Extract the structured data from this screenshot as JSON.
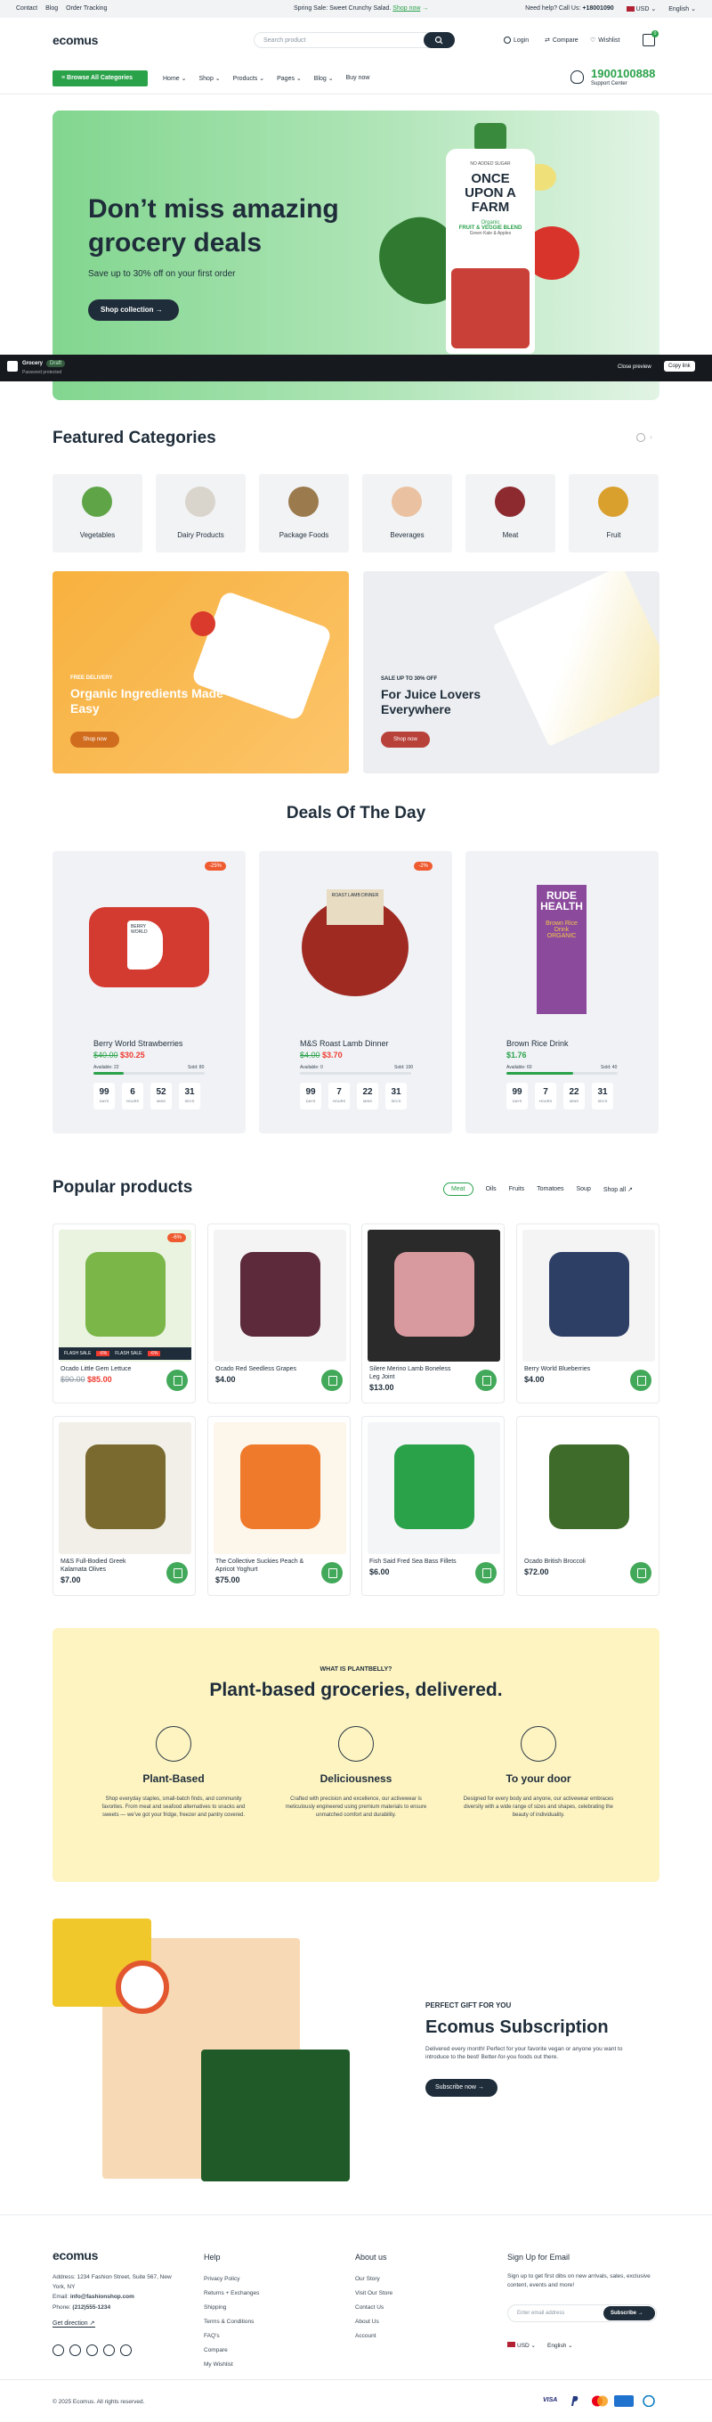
{
  "topbar": {
    "links": [
      "Contact",
      "Blog",
      "Order Tracking"
    ],
    "promo_text": "Spring Sale: Sweet Crunchy Salad.",
    "promo_link": "Shop now",
    "help_text": "Need help? Call Us:",
    "help_phone": "+18001090",
    "currency": "USD",
    "language": "English"
  },
  "header": {
    "logo": "ecomus",
    "search_placeholder": "Search product",
    "login": "Login",
    "compare": "Compare",
    "wishlist": "Wishlist",
    "cart_count": "0"
  },
  "nav": {
    "browse": "Browse All Categories",
    "items": [
      "Home",
      "Shop",
      "Products",
      "Pages",
      "Blog",
      "Buy now"
    ],
    "hotline": "1900100888",
    "hotline_sub": "Support Center"
  },
  "hero": {
    "title": "Don’t miss amazing grocery deals",
    "subtitle": "Save up to 30% off on your first order",
    "button": "Shop collection",
    "pack_line1": "NO ADDED SUGAR",
    "pack_brand": "ONCE UPON A FARM",
    "pack_line2": "Organic",
    "pack_line3": "FRUIT & VEGGIE BLEND",
    "pack_line4": "Green Kale & Apples"
  },
  "preview_bar": {
    "store": "Grocery",
    "badge": "Draft",
    "sub": "Password protected",
    "close": "Close preview",
    "copy": "Copy link"
  },
  "featured": {
    "title": "Featured Categories",
    "items": [
      {
        "label": "Vegetables",
        "color": "#5fa548"
      },
      {
        "label": "Dairy Products",
        "color": "#d9d4cc"
      },
      {
        "label": "Package Foods",
        "color": "#9b7a4e"
      },
      {
        "label": "Beverages",
        "color": "#eac2a1"
      },
      {
        "label": "Meat",
        "color": "#8c2a2f"
      },
      {
        "label": "Fruit",
        "color": "#d9a02d"
      }
    ]
  },
  "promos": [
    {
      "small": "FREE DELIVERY",
      "big": "Organic Ingredients Made Easy",
      "button": "Shop now"
    },
    {
      "small": "SALE UP TO 30% OFF",
      "big": "For Juice Lovers Everywhere",
      "button": "Shop now"
    }
  ],
  "deals": {
    "title": "Deals Of The Day",
    "items": [
      {
        "discount": "-25%",
        "name": "Berry World Strawberries",
        "old_price": "$40.00",
        "price": "$30.25",
        "available": "Available: 22",
        "sold": "Sold: 80",
        "progress": 0.27,
        "timer": [
          "99",
          "6",
          "52",
          "31"
        ],
        "pack_brand": "BERRY WORLD",
        "pack_text": "BRITISH STRAWBERRIES"
      },
      {
        "discount": "-2%",
        "name": "M&S Roast Lamb Dinner",
        "old_price": "$4.00",
        "price": "$3.70",
        "available": "Available: 0",
        "sold": "Sold: 100",
        "progress": 0.0,
        "timer": [
          "99",
          "7",
          "22",
          "31"
        ],
        "pack_brand": "M&S",
        "pack_text": "ROAST LAMB DINNER"
      },
      {
        "discount": "",
        "name": "Brown Rice Drink",
        "old_price": "",
        "price": "$1.76",
        "available": "Available: 60",
        "sold": "Sold: 40",
        "progress": 0.6,
        "timer": [
          "99",
          "7",
          "22",
          "31"
        ],
        "pack_brand": "RUDE HEALTH",
        "pack_text": "Brown Rice Drink ORGANIC"
      }
    ],
    "timer_labels": [
      "DAYS",
      "HOURS",
      "MINS",
      "SECS"
    ]
  },
  "popular": {
    "title": "Popular products",
    "filters": [
      "Meat",
      "Oils",
      "Fruits",
      "Tomatoes",
      "Soup",
      "Shop all"
    ],
    "products": [
      {
        "name": "Ocado Little Gem Lettuce",
        "old_price": "$90.00",
        "price": "$85.00",
        "discount": "-6%",
        "flash": "FLASH SALE",
        "img_color": "#e9f3df",
        "accent": "#7ab648"
      },
      {
        "name": "Ocado Red Seedless Grapes",
        "old_price": "",
        "price": "$4.00",
        "discount": "",
        "img_color": "#f4f4f4",
        "accent": "#5c2a3a"
      },
      {
        "name": "Silere Merino Lamb Boneless Leg Joint",
        "old_price": "",
        "price": "$13.00",
        "discount": "",
        "img_color": "#2a2a2a",
        "accent": "#d89a9e"
      },
      {
        "name": "Berry World Blueberries",
        "old_price": "",
        "price": "$4.00",
        "discount": "",
        "img_color": "#f4f4f4",
        "accent": "#2e3f66"
      },
      {
        "name": "M&S Full-Bodied Greek Kalamata Olives",
        "old_price": "",
        "price": "$7.00",
        "discount": "",
        "img_color": "#f1efe7",
        "accent": "#7a6a2f"
      },
      {
        "name": "The Collective Suckies Peach & Apricot Yoghurt",
        "old_price": "",
        "price": "$75.00",
        "discount": "",
        "img_color": "#fdf6ea",
        "accent": "#ef7a2b"
      },
      {
        "name": "Fish Said Fred Sea Bass Fillets",
        "old_price": "",
        "price": "$6.00",
        "discount": "",
        "img_color": "#f3f5f6",
        "accent": "#2aa24a"
      },
      {
        "name": "Ocado British Broccoli",
        "old_price": "",
        "price": "$72.00",
        "discount": "",
        "img_color": "#ffffff",
        "accent": "#3f6b2a"
      }
    ]
  },
  "plant": {
    "kicker": "WHAT IS PLANTBELLY?",
    "title": "Plant-based groceries, delivered.",
    "features": [
      {
        "title": "Plant-Based",
        "desc": "Shop everyday staples, small-batch finds, and community favorites. From meat and seafood alternatives to snacks and sweets — we’ve got your fridge, freezer and pantry covered."
      },
      {
        "title": "Deliciousness",
        "desc": "Crafted with precision and excellence, our activewear is meticulously engineered using premium materials to ensure unmatched comfort and durability."
      },
      {
        "title": "To your door",
        "desc": "Designed for every body and anyone, our activewear embraces diversity with a wide range of sizes and shapes, celebrating the beauty of individuality."
      }
    ]
  },
  "subscription": {
    "kicker": "PERFECT GIFT FOR YOU",
    "title": "Ecomus Subscription",
    "desc": "Delivered every month! Perfect for your favorite vegan or anyone you want to introduce to the best! Better-for-you foods out there.",
    "button": "Subscribe now"
  },
  "footer": {
    "logo": "ecomus",
    "address": "Address: 1234 Fashion Street, Suite 567, New York, NY",
    "email_label": "Email:",
    "email": "info@fashionshop.com",
    "phone_label": "Phone:",
    "phone": "(212)555-1234",
    "direction": "Get direction",
    "help_title": "Help",
    "help_links": [
      "Privacy Policy",
      "Returns + Exchanges",
      "Shipping",
      "Terms & Conditions",
      "FAQ’s",
      "Compare",
      "My Wishlist"
    ],
    "about_title": "About us",
    "about_links": [
      "Our Story",
      "Visit Our Store",
      "Contact Us",
      "About Us",
      "Account"
    ],
    "signup_title": "Sign Up for Email",
    "signup_desc": "Sign up to get first dibs on new arrivals, sales, exclusive content, events and more!",
    "email_placeholder": "Enter email address",
    "subscribe": "Subscribe",
    "currency": "USD",
    "language": "English",
    "copyright": "© 2025 Ecomus. All rights reserved.",
    "payments": [
      "VISA",
      "PayPal",
      "Mastercard",
      "Amex",
      "Diners"
    ]
  }
}
